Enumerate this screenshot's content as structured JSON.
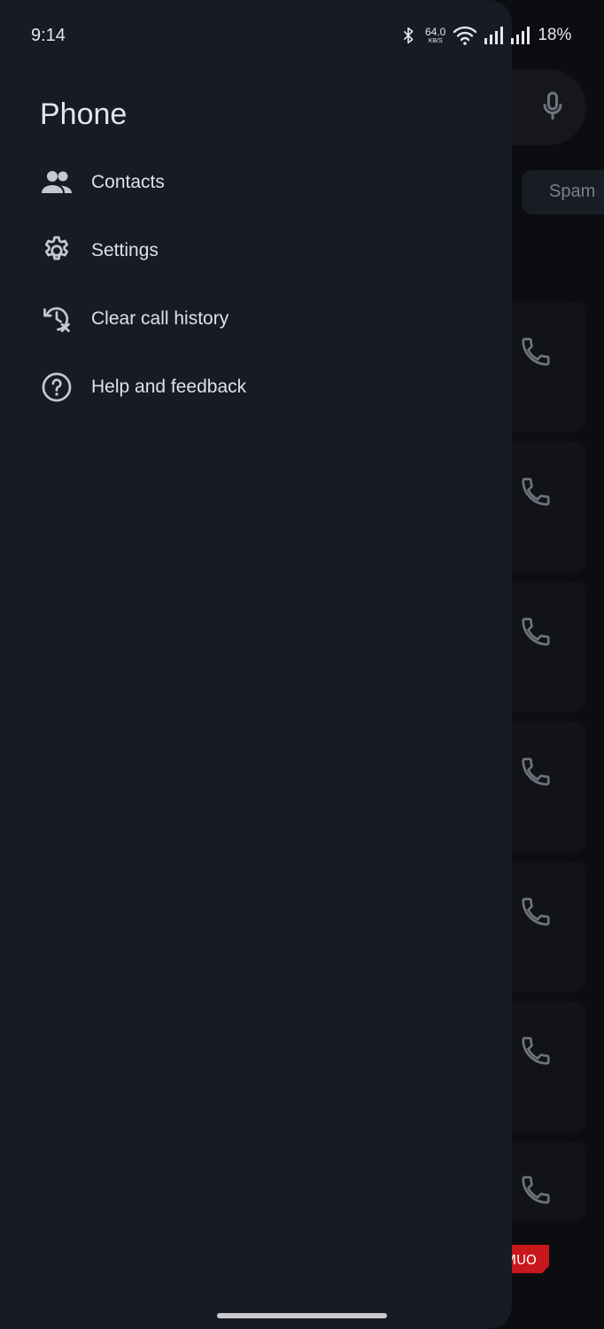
{
  "status_bar": {
    "time": "9:14",
    "net_speed_value": "64.0",
    "net_speed_unit": "KB/S",
    "battery": "18%",
    "icons": [
      "bluetooth-icon",
      "wifi-icon",
      "signal-icon",
      "signal-icon"
    ]
  },
  "drawer": {
    "title": "Phone",
    "items": [
      {
        "label": "Contacts",
        "icon": "contacts-icon"
      },
      {
        "label": "Settings",
        "icon": "gear-icon"
      },
      {
        "label": "Clear call history",
        "icon": "clear-history-icon"
      },
      {
        "label": "Help and feedback",
        "icon": "help-icon"
      }
    ]
  },
  "background": {
    "chip_label": "Spam",
    "icons": [
      "mic-icon",
      "phone-icon"
    ],
    "watermark_text": "MUO"
  },
  "colors": {
    "drawer_bg": "#181a24",
    "text": "#dfe1e8",
    "icon": "#c4c8d4",
    "watermark": "#c8171d"
  }
}
